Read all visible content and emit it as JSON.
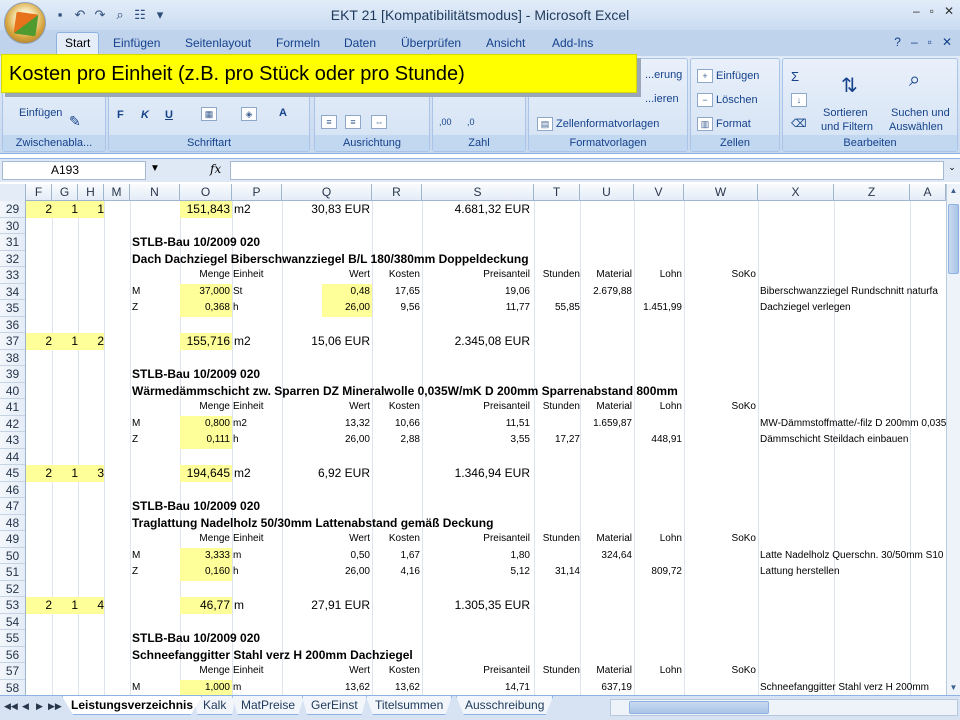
{
  "window": {
    "title": "EKT 21  [Kompatibilitätsmodus] - Microsoft Excel"
  },
  "ribbon_tabs": [
    "Start",
    "Einfügen",
    "Seitenlayout",
    "Formeln",
    "Daten",
    "Überprüfen",
    "Ansicht",
    "Add-Ins"
  ],
  "ribbon": {
    "clipboard": {
      "paste": "Einfügen",
      "label": "Zwischenabla..."
    },
    "font": {
      "label": "Schriftart",
      "bold": "F",
      "italic": "K",
      "underline": "U"
    },
    "alignment": {
      "label": "Ausrichtung"
    },
    "number": {
      "label": "Zahl",
      "dec_inc": ",00",
      "dec_dec": ",0"
    },
    "styles": {
      "label": "Formatvorlagen",
      "conditional": "...erung",
      "table": "...ieren",
      "cell_styles": "Zellenformatvorlagen"
    },
    "cells": {
      "label": "Zellen",
      "insert": "Einfügen",
      "delete": "Löschen",
      "format": "Format"
    },
    "editing": {
      "label": "Bearbeiten",
      "sum": "Σ",
      "sort_filter_1": "Sortieren",
      "sort_filter_2": "und Filtern",
      "find_1": "Suchen und",
      "find_2": "Auswählen"
    }
  },
  "callout": {
    "text": "Kosten pro Einheit (z.B. pro Stück oder pro Stunde)"
  },
  "formula_bar": {
    "name_box": "A193",
    "fx": "fx",
    "value": ""
  },
  "columns": [
    "F",
    "G",
    "H",
    "M",
    "N",
    "O",
    "P",
    "Q",
    "R",
    "S",
    "T",
    "U",
    "V",
    "W",
    "X",
    "Z",
    "A"
  ],
  "rows": [
    {
      "n": "29",
      "kind": "sum",
      "f": "2",
      "g": "1",
      "h": "1",
      "menge": "151,843",
      "einheit": "m2",
      "wert": "30,83 EUR",
      "preis": "4.681,32 EUR"
    },
    {
      "n": "30",
      "kind": "empty"
    },
    {
      "n": "31",
      "kind": "title",
      "text": "STLB-Bau 10/2009 020"
    },
    {
      "n": "32",
      "kind": "title",
      "text": "Dach Dachziegel Biberschwanzziegel B/L 180/380mm Doppeldeckung"
    },
    {
      "n": "33",
      "kind": "head",
      "menge": "Menge",
      "einheit": "Einheit",
      "wert": "Wert",
      "kosten": "Kosten",
      "preis": "Preisanteil",
      "stunden": "Stunden",
      "material": "Material",
      "lohn": "Lohn",
      "soko": "SoKo"
    },
    {
      "n": "34",
      "kind": "detail",
      "typ": "M",
      "menge": "37,000",
      "einheit": "St",
      "wert": "0,48",
      "wert_hl": true,
      "kosten": "17,65",
      "preis": "19,06",
      "stunden": "",
      "material": "2.679,88",
      "lohn": "",
      "desc": "Biberschwanzziegel Rundschnitt naturfa"
    },
    {
      "n": "35",
      "kind": "detail",
      "typ": "Z",
      "menge": "0,368",
      "einheit": "h",
      "wert": "26,00",
      "wert_hl": true,
      "kosten": "9,56",
      "preis": "11,77",
      "stunden": "55,85",
      "material": "",
      "lohn": "1.451,99",
      "desc": "Dachziegel verlegen"
    },
    {
      "n": "36",
      "kind": "empty"
    },
    {
      "n": "37",
      "kind": "sum",
      "f": "2",
      "g": "1",
      "h": "2",
      "menge": "155,716",
      "einheit": "m2",
      "wert": "15,06 EUR",
      "preis": "2.345,08 EUR"
    },
    {
      "n": "38",
      "kind": "empty"
    },
    {
      "n": "39",
      "kind": "title",
      "text": "STLB-Bau 10/2009 020"
    },
    {
      "n": "40",
      "kind": "title",
      "text": "Wärmedämmschicht zw. Sparren DZ Mineralwolle 0,035W/mK D 200mm Sparrenabstand 800mm"
    },
    {
      "n": "41",
      "kind": "head",
      "menge": "Menge",
      "einheit": "Einheit",
      "wert": "Wert",
      "kosten": "Kosten",
      "preis": "Preisanteil",
      "stunden": "Stunden",
      "material": "Material",
      "lohn": "Lohn",
      "soko": "SoKo"
    },
    {
      "n": "42",
      "kind": "detail",
      "typ": "M",
      "menge": "0,800",
      "einheit": "m2",
      "wert": "13,32",
      "kosten": "10,66",
      "preis": "11,51",
      "stunden": "",
      "material": "1.659,87",
      "lohn": "",
      "desc": "MW-Dämmstoffmatte/-filz D 200mm 0,035"
    },
    {
      "n": "43",
      "kind": "detail",
      "typ": "Z",
      "menge": "0,111",
      "einheit": "h",
      "wert": "26,00",
      "kosten": "2,88",
      "preis": "3,55",
      "stunden": "17,27",
      "material": "",
      "lohn": "448,91",
      "desc": "Dämmschicht Steildach einbauen"
    },
    {
      "n": "44",
      "kind": "empty"
    },
    {
      "n": "45",
      "kind": "sum",
      "f": "2",
      "g": "1",
      "h": "3",
      "menge": "194,645",
      "einheit": "m2",
      "wert": "6,92 EUR",
      "preis": "1.346,94 EUR"
    },
    {
      "n": "46",
      "kind": "empty"
    },
    {
      "n": "47",
      "kind": "title",
      "text": "STLB-Bau 10/2009 020"
    },
    {
      "n": "48",
      "kind": "title",
      "text": "Traglattung Nadelholz 50/30mm Lattenabstand gemäß Deckung"
    },
    {
      "n": "49",
      "kind": "head",
      "menge": "Menge",
      "einheit": "Einheit",
      "wert": "Wert",
      "kosten": "Kosten",
      "preis": "Preisanteil",
      "stunden": "Stunden",
      "material": "Material",
      "lohn": "Lohn",
      "soko": "SoKo"
    },
    {
      "n": "50",
      "kind": "detail",
      "typ": "M",
      "menge": "3,333",
      "einheit": "m",
      "wert": "0,50",
      "kosten": "1,67",
      "preis": "1,80",
      "stunden": "",
      "material": "324,64",
      "lohn": "",
      "desc": "Latte Nadelholz Querschn. 30/50mm S10"
    },
    {
      "n": "51",
      "kind": "detail",
      "typ": "Z",
      "menge": "0,160",
      "einheit": "h",
      "wert": "26,00",
      "kosten": "4,16",
      "preis": "5,12",
      "stunden": "31,14",
      "material": "",
      "lohn": "809,72",
      "desc": "Lattung herstellen"
    },
    {
      "n": "52",
      "kind": "empty"
    },
    {
      "n": "53",
      "kind": "sum",
      "f": "2",
      "g": "1",
      "h": "4",
      "menge": "46,77",
      "einheit": "m",
      "wert": "27,91 EUR",
      "preis": "1.305,35 EUR"
    },
    {
      "n": "54",
      "kind": "empty"
    },
    {
      "n": "55",
      "kind": "title",
      "text": "STLB-Bau 10/2009 020"
    },
    {
      "n": "56",
      "kind": "title",
      "text": "Schneefanggitter Stahl verz H 200mm Dachziegel"
    },
    {
      "n": "57",
      "kind": "head",
      "menge": "Menge",
      "einheit": "Einheit",
      "wert": "Wert",
      "kosten": "Kosten",
      "preis": "Preisanteil",
      "stunden": "Stunden",
      "material": "Material",
      "lohn": "Lohn",
      "soko": "SoKo"
    },
    {
      "n": "58",
      "kind": "detail",
      "typ": "M",
      "menge": "1,000",
      "einheit": "m",
      "wert": "13,62",
      "kosten": "13,62",
      "preis": "14,71",
      "stunden": "",
      "material": "637,19",
      "lohn": "",
      "desc": "Schneefanggitter Stahl verz H 200mm"
    }
  ],
  "sheet_tabs": [
    "Leistungsverzeichnis",
    "Kalk",
    "MatPreise",
    "GerEinst",
    "Titelsummen",
    "Ausschreibung"
  ],
  "active_sheet": "Leistungsverzeichnis"
}
